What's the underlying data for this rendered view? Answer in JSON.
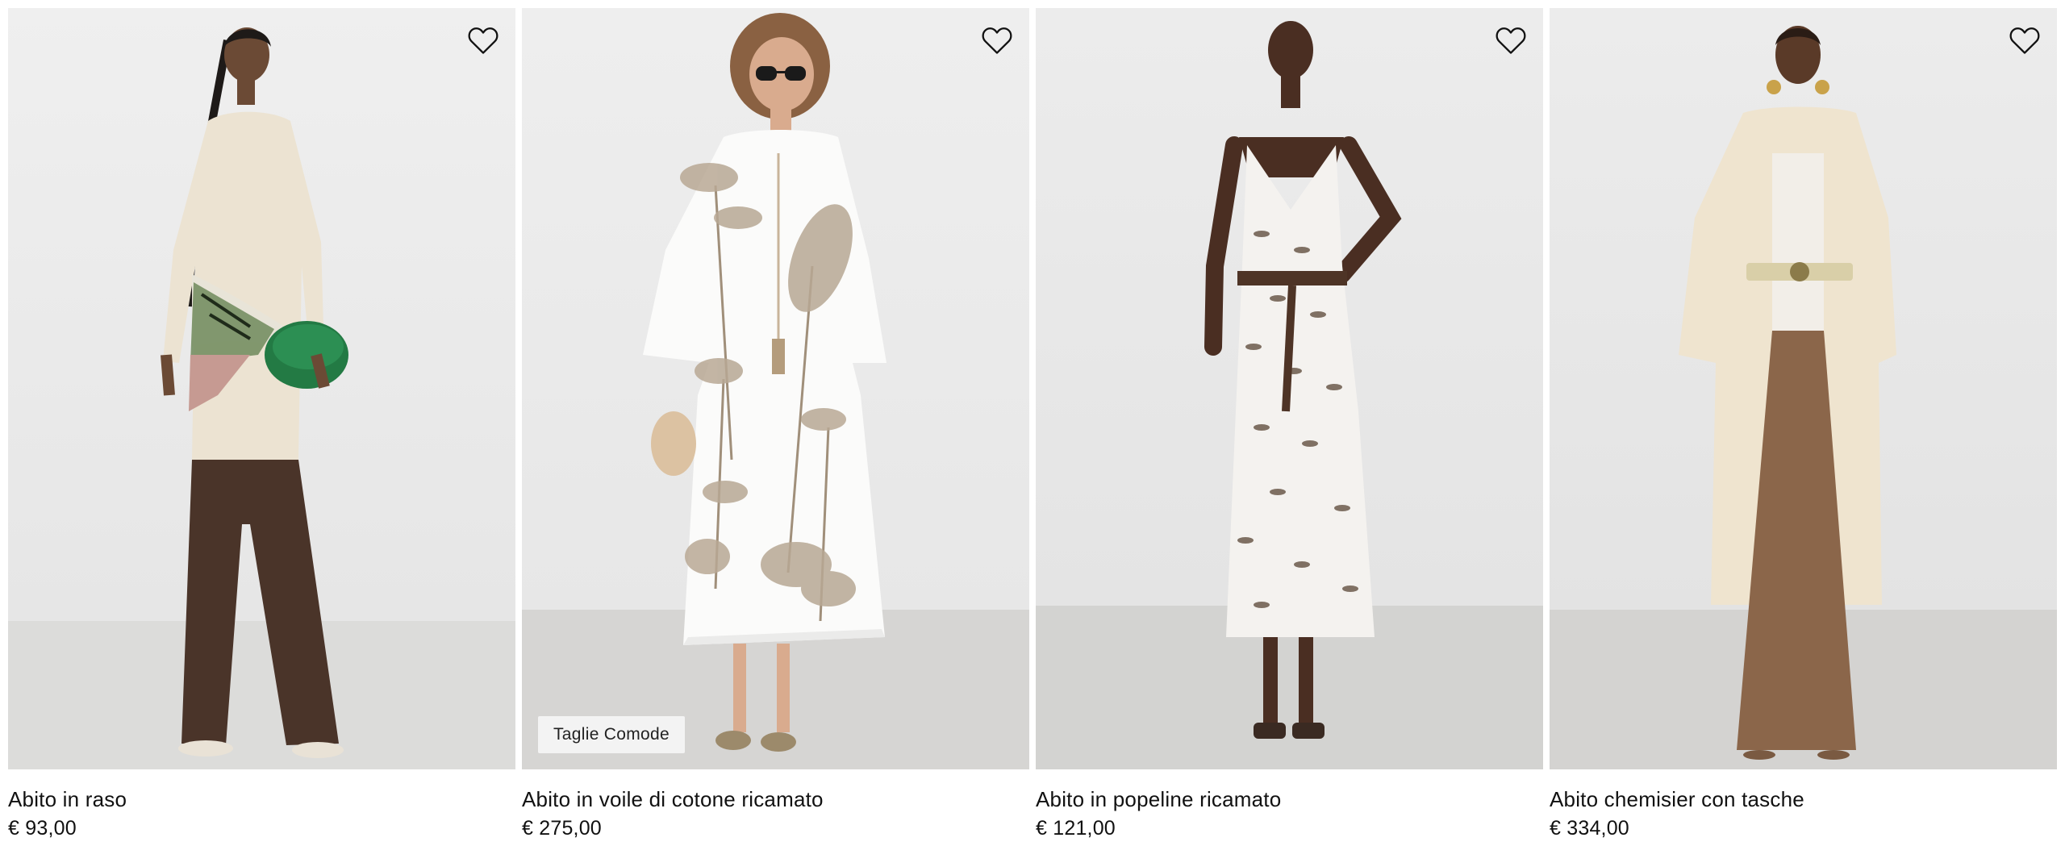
{
  "products": [
    {
      "name": "Abito in raso",
      "price": "€ 93,00",
      "badge": ""
    },
    {
      "name": "Abito in voile di cotone ricamato",
      "price": "€ 275,00",
      "badge": "Taglie Comode"
    },
    {
      "name": "Abito in popeline ricamato",
      "price": "€ 121,00",
      "badge": ""
    },
    {
      "name": "Abito chemisier con tasche",
      "price": "€ 334,00",
      "badge": ""
    }
  ],
  "icons": {
    "wishlist": "heart-outline-icon"
  },
  "colors": {
    "background": "#ffffff",
    "studio_wall": "#ececec",
    "studio_floor": "#d8d8d6",
    "text": "#111111",
    "badge_bg": "#f3f3f3"
  }
}
